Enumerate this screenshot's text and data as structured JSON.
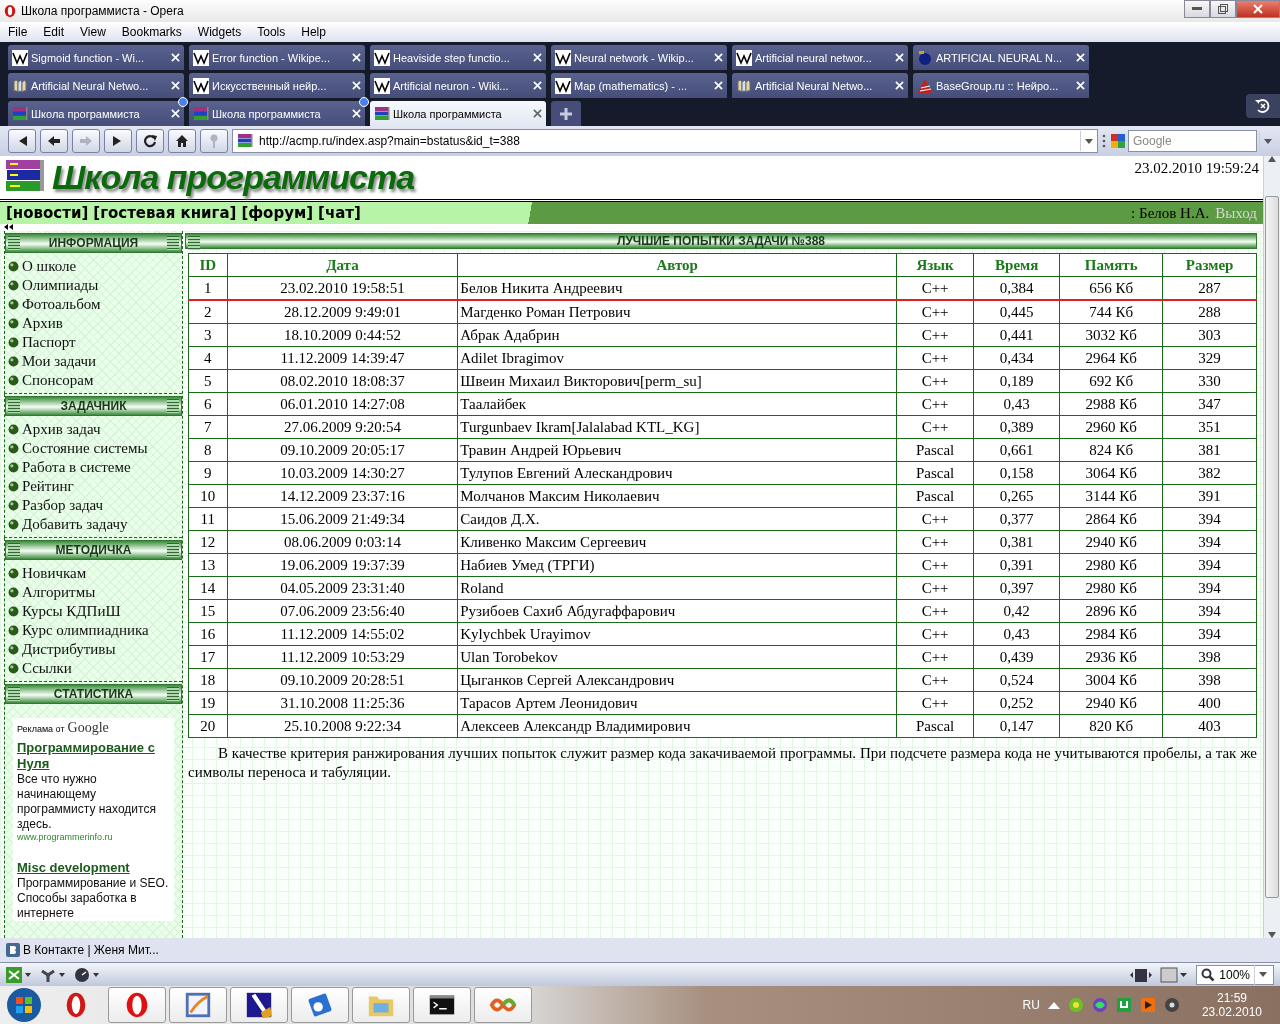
{
  "window": {
    "title": "Школа программиста - Opera"
  },
  "menu": [
    "File",
    "Edit",
    "View",
    "Bookmarks",
    "Widgets",
    "Tools",
    "Help"
  ],
  "tab_rows": [
    [
      {
        "label": "Sigmoid function - Wi...",
        "selected": false,
        "unread": false
      },
      {
        "label": "Error function - Wikipe...",
        "selected": false,
        "unread": false
      },
      {
        "label": "Heaviside step functio...",
        "selected": false,
        "unread": false
      },
      {
        "label": "Neural network - Wikip...",
        "selected": false,
        "unread": false
      },
      {
        "label": "Artificial neural networ...",
        "selected": false,
        "unread": false
      },
      {
        "label": "ARTIFICIAL NEURAL N...",
        "selected": false,
        "unread": false
      }
    ],
    [
      {
        "label": "Artificial Neural Netwo...",
        "selected": false,
        "unread": false
      },
      {
        "label": "Искусственный нейр...",
        "selected": false,
        "unread": false
      },
      {
        "label": "Artificial neuron - Wiki...",
        "selected": false,
        "unread": false
      },
      {
        "label": "Map (mathematics) - ...",
        "selected": false,
        "unread": false
      },
      {
        "label": "Artificial Neural Netwo...",
        "selected": false,
        "unread": false
      },
      {
        "label": "BaseGroup.ru :: Нейро...",
        "selected": false,
        "unread": false
      }
    ],
    [
      {
        "label": "Школа программиста",
        "selected": false,
        "unread": true
      },
      {
        "label": "Школа программиста",
        "selected": false,
        "unread": true
      },
      {
        "label": "Школа программиста",
        "selected": true,
        "unread": false
      }
    ]
  ],
  "nav_buttons": [
    {
      "kind": "first",
      "disabled": false
    },
    {
      "kind": "back",
      "disabled": false
    },
    {
      "kind": "forward",
      "disabled": true
    },
    {
      "kind": "last",
      "disabled": false
    },
    {
      "kind": "reload",
      "disabled": false
    },
    {
      "kind": "home",
      "disabled": false
    },
    {
      "kind": "key",
      "disabled": true
    }
  ],
  "address": {
    "url": "http://acmp.ru/index.asp?main=bstatus&id_t=388"
  },
  "search": {
    "placeholder": "Google"
  },
  "site": {
    "title": "Школа программиста",
    "datetime": "23.02.2010 19:59:24",
    "nav_links": [
      "[новости]",
      "[гостевая книга]",
      "[форум]",
      "[чат]"
    ],
    "user": ": Белов Н.А.",
    "logout": "Выход"
  },
  "sidebar": [
    {
      "title": "ИНФОРМАЦИЯ",
      "items": [
        "О школе",
        "Олимпиады",
        "Фотоальбом",
        "Архив",
        "Паспорт",
        "Мои задачи",
        "Спонсорам"
      ]
    },
    {
      "title": "ЗАДАЧНИК",
      "items": [
        "Архив задач",
        "Состояние системы",
        "Работа в системе",
        "Рейтинг",
        "Разбор задач",
        "Добавить задачу"
      ]
    },
    {
      "title": "МЕТОДИЧКА",
      "items": [
        "Новичкам",
        "Алгоритмы",
        "Курсы КДПиШ",
        "Курс олимпиадника",
        "Дистрибутивы",
        "Ссылки"
      ]
    },
    {
      "title": "СТАТИСТИКА"
    }
  ],
  "ads": {
    "label": "Реклама от",
    "brand": "Google",
    "items": [
      {
        "title": "Программирование с Нуля",
        "text": "Все что нужно начинающему программисту находится здесь.",
        "url": "www.programmerinfo.ru"
      },
      {
        "title": "Misc development",
        "text": "Программирование и SEO. Способы заработка в интернете"
      }
    ]
  },
  "table": {
    "title": "ЛУЧШИЕ ПОПЫТКИ ЗАДАЧИ №388",
    "columns": [
      "ID",
      "Дата",
      "Автор",
      "Язык",
      "Время",
      "Память",
      "Размер"
    ],
    "rows": [
      {
        "cells": [
          "1",
          "23.02.2010 19:58:51",
          "Белов Никита Андреевич",
          "C++",
          "0,384",
          "656 Кб",
          "287"
        ],
        "marked": true
      },
      {
        "cells": [
          "2",
          "28.12.2009 9:49:01",
          "Магденко Роман Петрович",
          "C++",
          "0,445",
          "744 Кб",
          "288"
        ],
        "marked": false
      },
      {
        "cells": [
          "3",
          "18.10.2009 0:44:52",
          "Абрак Адабрин",
          "C++",
          "0,441",
          "3032 Кб",
          "303"
        ],
        "marked": false
      },
      {
        "cells": [
          "4",
          "11.12.2009 14:39:47",
          "Adilet Ibragimov",
          "C++",
          "0,434",
          "2964 Кб",
          "329"
        ],
        "marked": false
      },
      {
        "cells": [
          "5",
          "08.02.2010 18:08:37",
          "Швеин Михаил Викторович[perm_su]",
          "C++",
          "0,189",
          "692 Кб",
          "330"
        ],
        "marked": false
      },
      {
        "cells": [
          "6",
          "06.01.2010 14:27:08",
          "Таалайбек",
          "C++",
          "0,43",
          "2988 Кб",
          "347"
        ],
        "marked": false
      },
      {
        "cells": [
          "7",
          "27.06.2009 9:20:54",
          "Turgunbaev Ikram[Jalalabad KTL_KG]",
          "C++",
          "0,389",
          "2960 Кб",
          "351"
        ],
        "marked": false
      },
      {
        "cells": [
          "8",
          "09.10.2009 20:05:17",
          "Травин Андрей Юрьевич",
          "Pascal",
          "0,661",
          "824 Кб",
          "381"
        ],
        "marked": false
      },
      {
        "cells": [
          "9",
          "10.03.2009 14:30:27",
          "Тулупов Евгений Алескандрович",
          "Pascal",
          "0,158",
          "3064 Кб",
          "382"
        ],
        "marked": false
      },
      {
        "cells": [
          "10",
          "14.12.2009 23:37:16",
          "Молчанов Максим Николаевич",
          "Pascal",
          "0,265",
          "3144 Кб",
          "391"
        ],
        "marked": false
      },
      {
        "cells": [
          "11",
          "15.06.2009 21:49:34",
          "Саидов Д.Х.",
          "C++",
          "0,377",
          "2864 Кб",
          "394"
        ],
        "marked": false
      },
      {
        "cells": [
          "12",
          "08.06.2009 0:03:14",
          "Кливенко Максим Сергеевич",
          "C++",
          "0,381",
          "2940 Кб",
          "394"
        ],
        "marked": false
      },
      {
        "cells": [
          "13",
          "19.06.2009 19:37:39",
          "Набиев Умед (ТРГИ)",
          "C++",
          "0,391",
          "2980 Кб",
          "394"
        ],
        "marked": false
      },
      {
        "cells": [
          "14",
          "04.05.2009 23:31:40",
          "Roland",
          "C++",
          "0,397",
          "2980 Кб",
          "394"
        ],
        "marked": false
      },
      {
        "cells": [
          "15",
          "07.06.2009 23:56:40",
          "Рузибоев Сахиб Абдугаффарович",
          "C++",
          "0,42",
          "2896 Кб",
          "394"
        ],
        "marked": false
      },
      {
        "cells": [
          "16",
          "11.12.2009 14:55:02",
          "Kylychbek Urayimov",
          "C++",
          "0,43",
          "2984 Кб",
          "394"
        ],
        "marked": false
      },
      {
        "cells": [
          "17",
          "11.12.2009 10:53:29",
          "Ulan Torobekov",
          "C++",
          "0,439",
          "2936 Кб",
          "398"
        ],
        "marked": false
      },
      {
        "cells": [
          "18",
          "09.10.2009 20:28:51",
          "Цыганков Сергей Александрович",
          "C++",
          "0,524",
          "3004 Кб",
          "398"
        ],
        "marked": false
      },
      {
        "cells": [
          "19",
          "31.10.2008 11:25:36",
          "Тарасов Артем Леонидович",
          "C++",
          "0,252",
          "2940 Кб",
          "400"
        ],
        "marked": false
      },
      {
        "cells": [
          "20",
          "25.10.2008 9:22:34",
          "Алексеев Александр Владимирович",
          "Pascal",
          "0,147",
          "820 Кб",
          "403"
        ],
        "marked": false
      }
    ]
  },
  "note": "В качестве критерия ранжирования лучших попыток служит размер кода закачиваемой программы. При подсчете размера кода не учитываются пробелы, а так же символы переноса и табуляции.",
  "panel": {
    "label": "В Контакте | Женя Мит..."
  },
  "status": {
    "zoom": "100%"
  },
  "tray": {
    "lang": "RU",
    "time": "21:59",
    "date": "23.02.2010"
  }
}
